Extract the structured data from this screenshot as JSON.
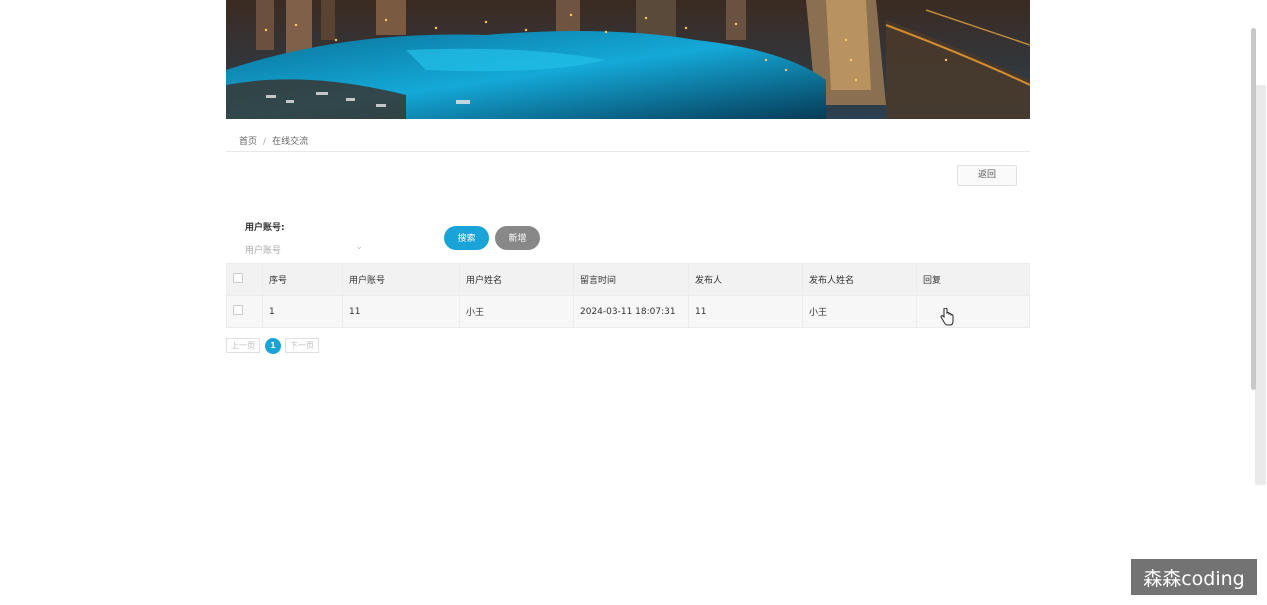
{
  "breadcrumb": {
    "home": "首页",
    "separator": "/",
    "current": "在线交流"
  },
  "actions": {
    "back_label": "返回"
  },
  "filter": {
    "label": "用户账号:",
    "placeholder": "用户账号",
    "search_label": "搜索",
    "add_label": "新增"
  },
  "table": {
    "headers": [
      "序号",
      "用户账号",
      "用户姓名",
      "留言时间",
      "发布人",
      "发布人姓名",
      "回复"
    ],
    "rows": [
      {
        "index": "1",
        "account": "11",
        "name": "小王",
        "time": "2024-03-11 18:07:31",
        "publisher": "11",
        "publisher_name": "小王",
        "reply": ""
      }
    ]
  },
  "pagination": {
    "prev_label": "上一页",
    "current": "1",
    "next_label": "下一页"
  },
  "watermark": "森森coding",
  "colors": {
    "accent": "#1aa3d6",
    "secondary": "#888888"
  }
}
